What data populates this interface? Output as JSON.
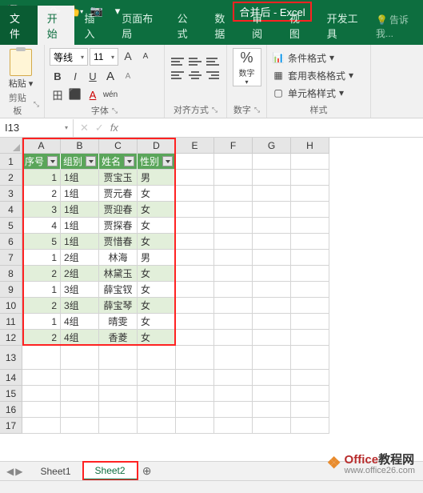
{
  "title": "合并后 - Excel",
  "qat": {
    "save": "💾",
    "undo": "↶",
    "redo": "↷",
    "touch": "👆",
    "camera": "📷"
  },
  "tabs": [
    "文件",
    "开始",
    "插入",
    "页面布局",
    "公式",
    "数据",
    "审阅",
    "视图",
    "开发工具"
  ],
  "tell_me": "告诉我...",
  "ribbon": {
    "clipboard": {
      "paste": "粘贴",
      "label": "剪贴板"
    },
    "font": {
      "name": "等线",
      "size": "11",
      "grow": "A",
      "shrink": "A",
      "bold": "B",
      "italic": "I",
      "underline": "U",
      "border": "田",
      "fill": "⬛",
      "color": "A",
      "phonetic": "wén",
      "label": "字体"
    },
    "align": {
      "label": "对齐方式"
    },
    "number": {
      "symbol": "%",
      "sublabel": "数字",
      "label": "数字"
    },
    "styles": {
      "cond": "条件格式",
      "table": "套用表格格式",
      "cell": "单元格样式",
      "label": "样式"
    }
  },
  "namebox": "I13",
  "fx": "fx",
  "columns": [
    "A",
    "B",
    "C",
    "D",
    "E",
    "F",
    "G",
    "H"
  ],
  "row_numbers": [
    1,
    2,
    3,
    4,
    5,
    6,
    7,
    8,
    9,
    10,
    11,
    12,
    13,
    14,
    15,
    16,
    17
  ],
  "headers": [
    "序号",
    "组别",
    "姓名",
    "性别"
  ],
  "rows": [
    {
      "seq": 1,
      "grp": "1组",
      "name": "贾宝玉",
      "sex": "男"
    },
    {
      "seq": 2,
      "grp": "1组",
      "name": "贾元春",
      "sex": "女"
    },
    {
      "seq": 3,
      "grp": "1组",
      "name": "贾迎春",
      "sex": "女"
    },
    {
      "seq": 4,
      "grp": "1组",
      "name": "贾探春",
      "sex": "女"
    },
    {
      "seq": 5,
      "grp": "1组",
      "name": "贾惜春",
      "sex": "女"
    },
    {
      "seq": 1,
      "grp": "2组",
      "name": "林海",
      "sex": "男"
    },
    {
      "seq": 2,
      "grp": "2组",
      "name": "林黛玉",
      "sex": "女"
    },
    {
      "seq": 1,
      "grp": "3组",
      "name": "薛宝钗",
      "sex": "女"
    },
    {
      "seq": 2,
      "grp": "3组",
      "name": "薛宝琴",
      "sex": "女"
    },
    {
      "seq": 1,
      "grp": "4组",
      "name": "晴雯",
      "sex": "女"
    },
    {
      "seq": 2,
      "grp": "4组",
      "name": "香菱",
      "sex": "女"
    }
  ],
  "sheets": [
    "Sheet1",
    "Sheet2"
  ],
  "watermark": {
    "brand": "Office",
    "suffix": "教程网",
    "url": "www.office26.com"
  }
}
